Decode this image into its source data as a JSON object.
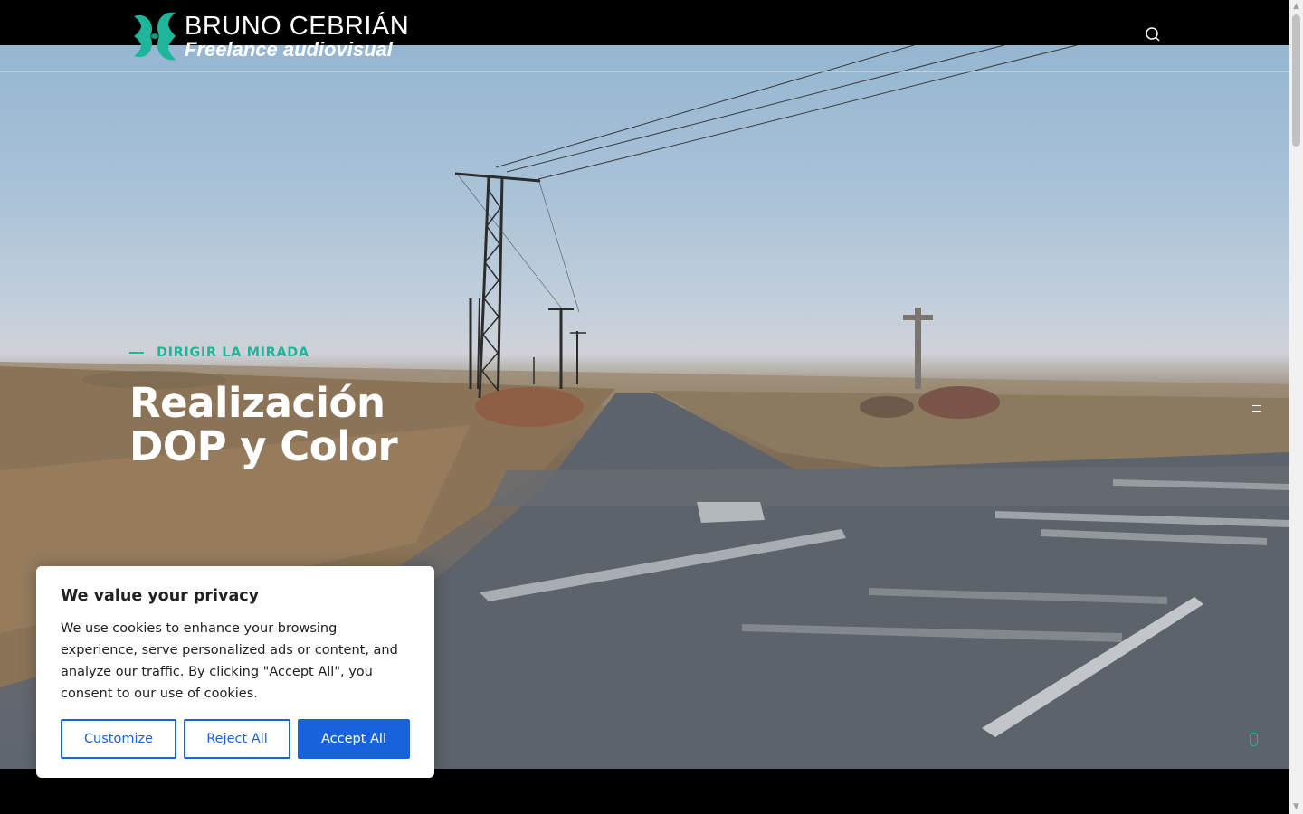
{
  "brand": {
    "name": "BRUNO CEBRIÁN",
    "tagline": "Freelance audiovisual",
    "accent_color": "#1fb59a"
  },
  "header": {
    "search_icon": "search-icon"
  },
  "hero": {
    "eyebrow": "DIRIGIR LA MIRADA",
    "title_line1": "Realización",
    "title_line2": "DOP y Color"
  },
  "cookie_banner": {
    "title": "We value your privacy",
    "text": "We use cookies to enhance your browsing experience, serve personalized ads or content, and analyze our traffic. By clicking \"Accept All\", you consent to our use of cookies.",
    "customize_label": "Customize",
    "reject_label": "Reject All",
    "accept_label": "Accept All",
    "button_color": "#1863dc"
  }
}
